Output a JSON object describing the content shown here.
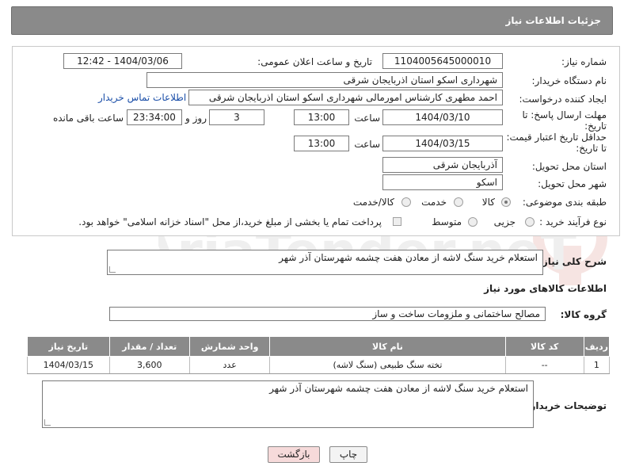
{
  "header": {
    "title": "جزئیات اطلاعات نیاز"
  },
  "form": {
    "need_number": {
      "label": "شماره نیاز:",
      "value": "1104005645000010"
    },
    "announce_datetime": {
      "label": "تاریخ و ساعت اعلان عمومی:",
      "value": "1404/03/06 - 12:42"
    },
    "buyer_org": {
      "label": "نام دستگاه خریدار:",
      "value": "شهرداری اسکو استان اذربایجان شرقی"
    },
    "requester": {
      "label": "ایجاد کننده درخواست:",
      "value": "احمد مطهری کارشناس امورمالی شهرداری اسکو استان اذربایجان شرقی",
      "contact_link": "اطلاعات تماس خریدار"
    },
    "reply_deadline": {
      "label_line1": "مهلت ارسال پاسخ: تا",
      "label_line2": "تاریخ:",
      "date": "1404/03/10",
      "time_label": "ساعت",
      "time": "13:00",
      "days": "3",
      "days_label": "روز و",
      "remaining": "23:34:00",
      "remaining_label": "ساعت باقی مانده"
    },
    "price_validity": {
      "label_line1": "حداقل تاریخ اعتبار قیمت:",
      "label_line2": "تا تاریخ:",
      "date": "1404/03/15",
      "time_label": "ساعت",
      "time": "13:00"
    },
    "delivery_province": {
      "label": "استان محل تحویل:",
      "value": "آذربایجان شرقی"
    },
    "delivery_city": {
      "label": "شهر محل تحویل:",
      "value": "اسکو"
    },
    "category": {
      "label": "طبقه بندی موضوعی:",
      "options": [
        "کالا",
        "خدمت",
        "کالا/خدمت"
      ],
      "selected": "کالا"
    },
    "process_type": {
      "label": "نوع فرآیند خرید :",
      "options": [
        "جزیی",
        "متوسط"
      ],
      "payment_note": "پرداخت تمام یا بخشی از مبلغ خرید،از محل \"اسناد خزانه اسلامی\" خواهد بود."
    }
  },
  "summary": {
    "label": "شرح کلی نیاز:",
    "value": "استعلام خرید سنگ لاشه از معادن هفت چشمه شهرستان آذر شهر"
  },
  "goods_section": {
    "title": "اطلاعات کالاهای مورد نیاز",
    "group_label": "گروه کالا:",
    "group_value": "مصالح ساختمانی و ملزومات ساخت و ساز"
  },
  "table": {
    "headers": [
      "ردیف",
      "کد کالا",
      "نام کالا",
      "واحد شمارش",
      "تعداد / مقدار",
      "تاریخ نیاز"
    ],
    "rows": [
      {
        "row": "1",
        "code": "--",
        "name": "تخته سنگ طبیعی (سنگ لاشه)",
        "unit": "عدد",
        "qty": "3,600",
        "date": "1404/03/15"
      }
    ]
  },
  "buyer_notes": {
    "label": "توضیحات خریدار:",
    "value": "استعلام خرید سنگ لاشه از معادن هفت چشمه شهرستان آذر شهر"
  },
  "buttons": {
    "print": "چاپ",
    "back": "بازگشت"
  },
  "watermark_text": "AriaTender.neT",
  "colors": {
    "header_bg": "#8a8a8a",
    "link": "#1a4ea8",
    "back_button_bg": "#f6dada",
    "watermark": "#c0392b"
  }
}
